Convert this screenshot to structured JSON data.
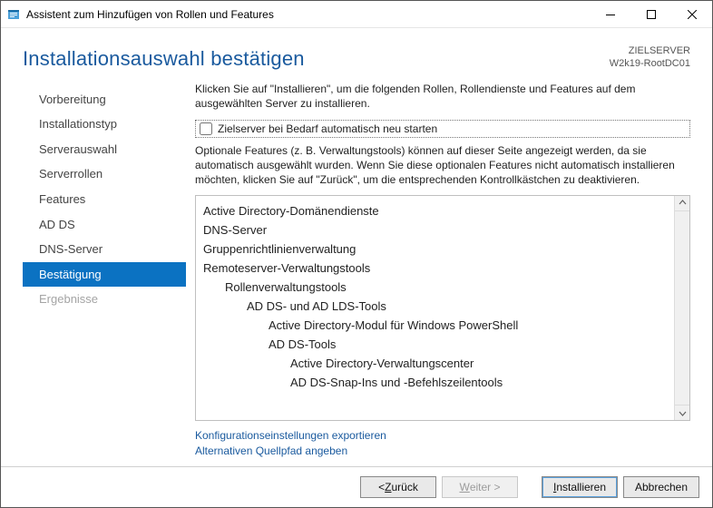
{
  "titlebar": {
    "title": "Assistent zum Hinzufügen von Rollen und Features"
  },
  "header": {
    "heading": "Installationsauswahl bestätigen",
    "meta_label": "ZIELSERVER",
    "meta_value": "W2k19-RootDC01"
  },
  "sidebar": {
    "items": [
      {
        "label": "Vorbereitung",
        "active": false,
        "disabled": false
      },
      {
        "label": "Installationstyp",
        "active": false,
        "disabled": false
      },
      {
        "label": "Serverauswahl",
        "active": false,
        "disabled": false
      },
      {
        "label": "Serverrollen",
        "active": false,
        "disabled": false
      },
      {
        "label": "Features",
        "active": false,
        "disabled": false
      },
      {
        "label": "AD DS",
        "active": false,
        "disabled": false
      },
      {
        "label": "DNS-Server",
        "active": false,
        "disabled": false
      },
      {
        "label": "Bestätigung",
        "active": true,
        "disabled": false
      },
      {
        "label": "Ergebnisse",
        "active": false,
        "disabled": true
      }
    ]
  },
  "content": {
    "intro": "Klicken Sie auf \"Installieren\", um die folgenden Rollen, Rollendienste und Features auf dem ausgewählten Server zu installieren.",
    "checkbox_label": "Zielserver bei Bedarf automatisch neu starten",
    "checkbox_checked": false,
    "note": "Optionale Features (z. B. Verwaltungstools) können auf dieser Seite angezeigt werden, da sie automatisch ausgewählt wurden. Wenn Sie diese optionalen Features nicht automatisch installieren möchten, klicken Sie auf \"Zurück\", um die entsprechenden Kontrollkästchen zu deaktivieren.",
    "items": [
      {
        "label": "Active Directory-Domänendienste",
        "level": 0
      },
      {
        "label": "DNS-Server",
        "level": 0
      },
      {
        "label": "Gruppenrichtlinienverwaltung",
        "level": 0
      },
      {
        "label": "Remoteserver-Verwaltungstools",
        "level": 0
      },
      {
        "label": "Rollenverwaltungstools",
        "level": 1
      },
      {
        "label": "AD DS- und AD LDS-Tools",
        "level": 2
      },
      {
        "label": "Active Directory-Modul für Windows PowerShell",
        "level": 3
      },
      {
        "label": "AD DS-Tools",
        "level": 3
      },
      {
        "label": "Active Directory-Verwaltungscenter",
        "level": 4
      },
      {
        "label": "AD DS-Snap-Ins und -Befehlszeilentools",
        "level": 4
      }
    ],
    "link_export": "Konfigurationseinstellungen exportieren",
    "link_altsource": "Alternativen Quellpfad angeben"
  },
  "footer": {
    "back_prefix": "< ",
    "back_key": "Z",
    "back_rest": "urück",
    "next_key": "W",
    "next_rest": "eiter >",
    "install_key": "I",
    "install_rest": "nstallieren",
    "cancel_label": "Abbrechen"
  }
}
